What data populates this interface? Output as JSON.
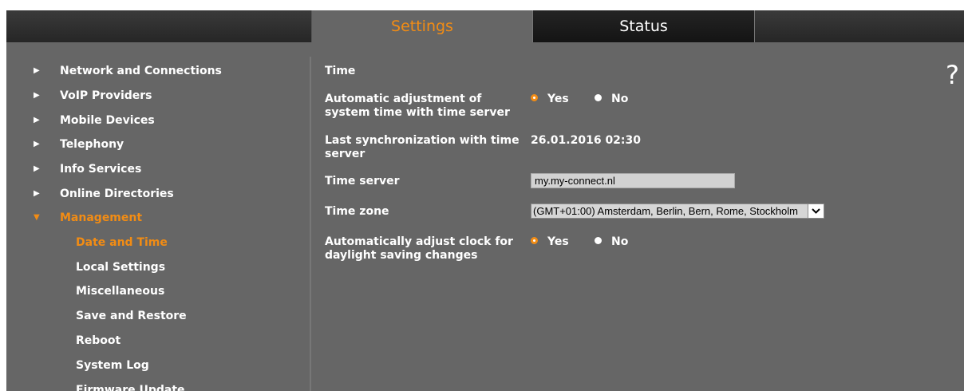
{
  "tabs": [
    {
      "label": "Settings",
      "active": true
    },
    {
      "label": "Status",
      "active": false
    }
  ],
  "sidebar": {
    "items": [
      {
        "label": "Network and Connections"
      },
      {
        "label": "VoIP Providers"
      },
      {
        "label": "Mobile Devices"
      },
      {
        "label": "Telephony"
      },
      {
        "label": "Info Services"
      },
      {
        "label": "Online Directories"
      },
      {
        "label": "Management",
        "expanded": true
      }
    ],
    "subitems": [
      {
        "label": "Date and Time",
        "active": true
      },
      {
        "label": "Local Settings"
      },
      {
        "label": "Miscellaneous"
      },
      {
        "label": "Save and Restore"
      },
      {
        "label": "Reboot"
      },
      {
        "label": "System Log"
      },
      {
        "label": "Firmware Update"
      }
    ]
  },
  "content": {
    "title": "Time",
    "help": "?",
    "auto_adjust": {
      "label": "Automatic adjustment of system time with time server",
      "yes_label": "Yes",
      "no_label": "No",
      "selected": "Yes"
    },
    "last_sync": {
      "label": "Last synchronization with time server",
      "value": "26.01.2016 02:30"
    },
    "time_server": {
      "label": "Time server",
      "value": "my.my-connect.nl"
    },
    "time_zone": {
      "label": "Time zone",
      "value": "(GMT+01:00) Amsterdam, Berlin, Bern, Rome, Stockholm"
    },
    "dst": {
      "label": "Automatically adjust clock for daylight saving changes",
      "yes_label": "Yes",
      "no_label": "No",
      "selected": "Yes"
    }
  },
  "colors": {
    "accent": "#f28c14",
    "background": "#666666",
    "topbar": "#2e2e2e"
  }
}
